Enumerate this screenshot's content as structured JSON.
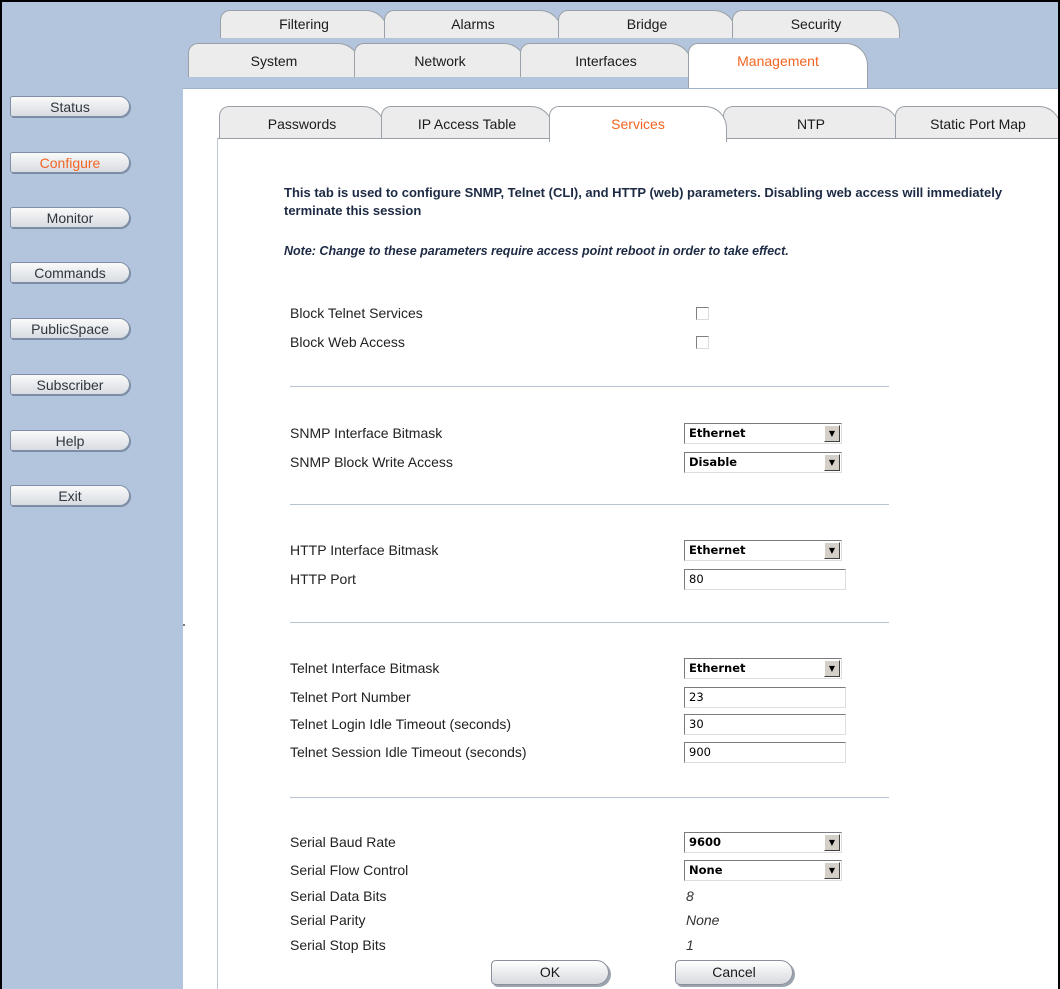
{
  "top_tabs_row1": [
    "Filtering",
    "Alarms",
    "Bridge",
    "Security"
  ],
  "top_tabs_row2": [
    "System",
    "Network",
    "Interfaces",
    "Management"
  ],
  "active_top_tab": "Management",
  "sub_tabs": [
    "Passwords",
    "IP Access Table",
    "Services",
    "NTP",
    "Static Port Map"
  ],
  "active_sub_tab": "Services",
  "sidebar": [
    "Status",
    "Configure",
    "Monitor",
    "Commands",
    "PublicSpace",
    "Subscriber",
    "Help",
    "Exit"
  ],
  "active_sidebar": "Configure",
  "description": "This tab is used to configure SNMP, Telnet (CLI), and HTTP (web) parameters. Disabling web access will immediately terminate this session",
  "note": "Note: Change to these parameters require access point reboot in order to take effect.",
  "block": {
    "telnet_label": "Block Telnet Services",
    "telnet_checked": false,
    "web_label": "Block Web Access",
    "web_checked": false
  },
  "snmp": {
    "bitmask_label": "SNMP Interface Bitmask",
    "bitmask_value": "Ethernet",
    "write_label": "SNMP Block Write Access",
    "write_value": "Disable"
  },
  "http": {
    "bitmask_label": "HTTP Interface Bitmask",
    "bitmask_value": "Ethernet",
    "port_label": "HTTP Port",
    "port_value": "80"
  },
  "telnet": {
    "bitmask_label": "Telnet Interface Bitmask",
    "bitmask_value": "Ethernet",
    "port_label": "Telnet Port Number",
    "port_value": "23",
    "login_label": "Telnet Login Idle Timeout (seconds)",
    "login_value": "30",
    "session_label": "Telnet Session Idle Timeout (seconds)",
    "session_value": "900"
  },
  "serial": {
    "baud_label": "Serial Baud Rate",
    "baud_value": "9600",
    "flow_label": "Serial Flow Control",
    "flow_value": "None",
    "data_bits_label": "Serial Data Bits",
    "data_bits_value": "8",
    "parity_label": "Serial Parity",
    "parity_value": "None",
    "stop_bits_label": "Serial Stop Bits",
    "stop_bits_value": "1"
  },
  "buttons": {
    "ok": "OK",
    "cancel": "Cancel"
  },
  "colors": {
    "accent": "#f26522",
    "band": "#b3c5dc",
    "text_dark": "#1d2a44"
  }
}
